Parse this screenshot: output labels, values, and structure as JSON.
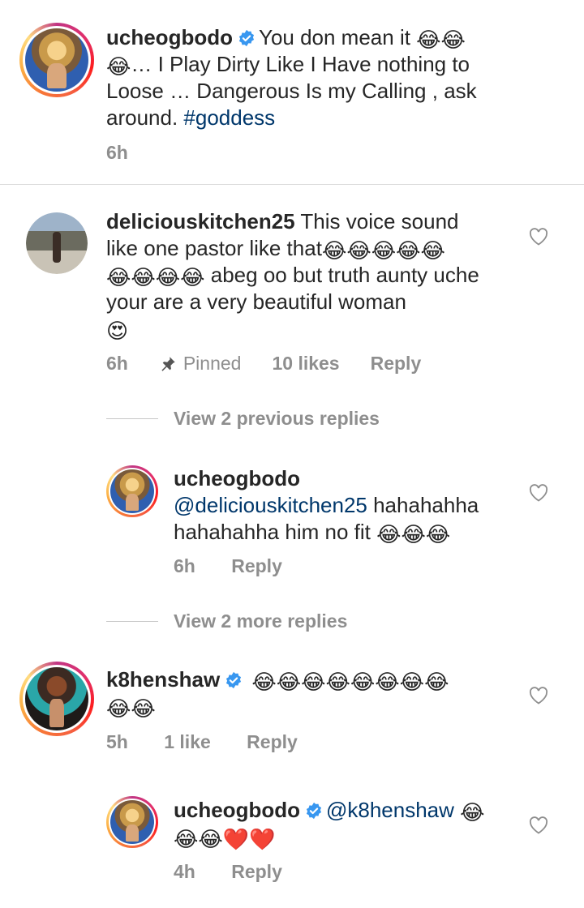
{
  "caption": {
    "username": "ucheogbodo",
    "text_a": "You don mean it ",
    "emoji_a": "😂😂",
    "emoji_b": "😂",
    "text_b": "… I Play Dirty Like I Have nothing to Loose … Dangerous Is my Calling , ask around.  ",
    "hashtag": "#goddess",
    "time": "6h",
    "avatar_icon": "profile-photo-ucheogbodo"
  },
  "comment1": {
    "username": "deliciouskitchen25",
    "text_a": " This voice sound like one pastor like that",
    "emoji_a": "😂😂😂😂😂",
    "emoji_b": "😂😂😂😂",
    "text_b": " abeg oo but truth aunty uche your are a very beautiful woman",
    "emoji_c": "😍",
    "time": "6h",
    "pinned": "Pinned",
    "likes": "10 likes",
    "reply": "Reply",
    "avatar_icon": "profile-photo-deliciouskitchen25"
  },
  "view_previous": "View 2 previous replies",
  "reply1": {
    "username": "ucheogbodo",
    "mention": "@deliciouskitchen25",
    "text": " hahahahha hahahahha him no fit ",
    "emoji": "😂😂😂",
    "time": "6h",
    "reply": "Reply"
  },
  "view_more": "View 2 more replies",
  "comment2": {
    "username": "k8henshaw",
    "emoji_a": "😂😂😂😂😂😂😂😂",
    "emoji_b": "😂😂",
    "time": "5h",
    "likes": "1 like",
    "reply": "Reply",
    "avatar_icon": "profile-photo-k8henshaw"
  },
  "reply2": {
    "username": "ucheogbodo",
    "mention": "@k8henshaw",
    "emoji_a": "😂",
    "emoji_b": "😂😂❤️❤️",
    "time": "4h",
    "reply": "Reply"
  },
  "colors": {
    "verified": "#3897f0",
    "link": "#00376b",
    "meta": "#8e8e8e"
  }
}
